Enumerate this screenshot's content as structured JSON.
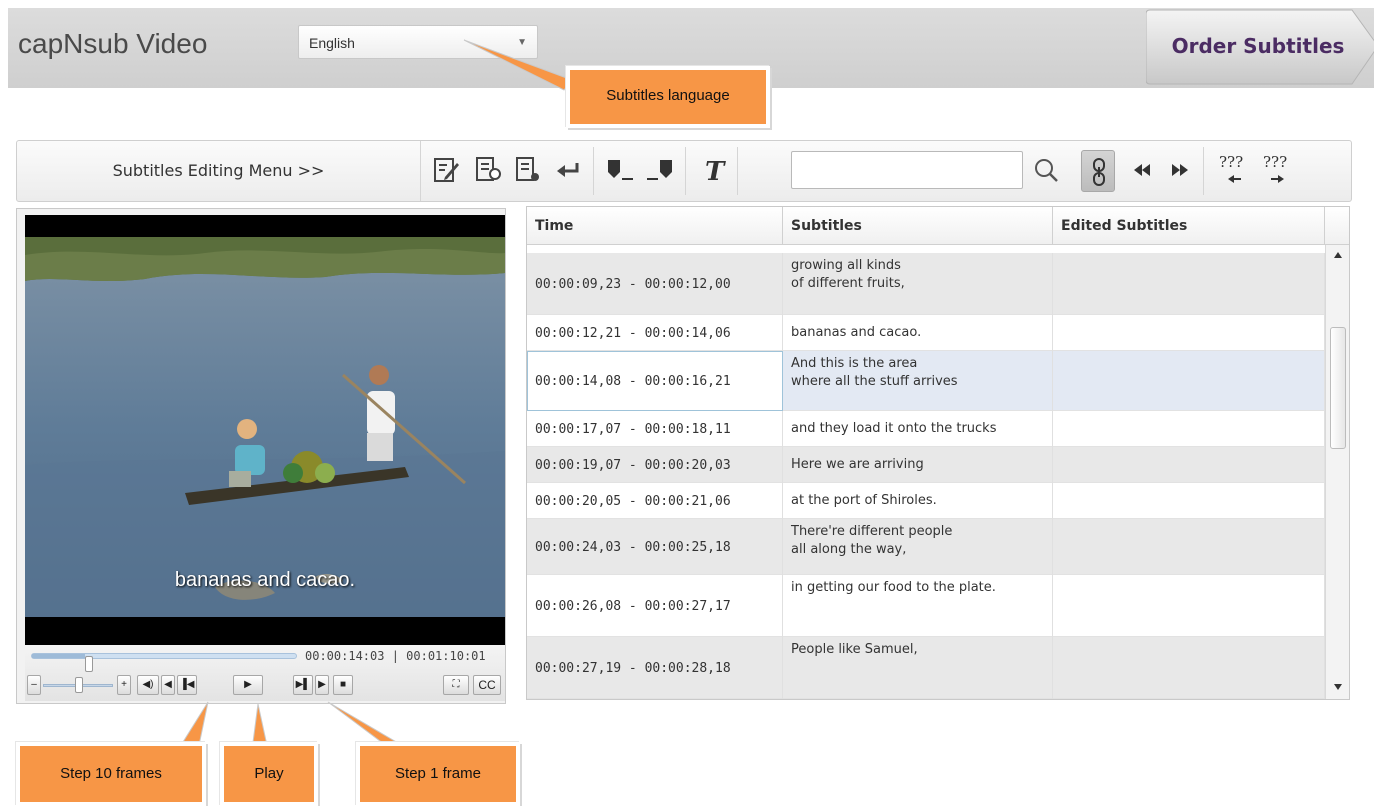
{
  "header": {
    "app_title": "capNsub Video",
    "language": {
      "selected": "English"
    },
    "order_button": "Order Subtitles"
  },
  "toolbar": {
    "menu_label": "Subtitles Editing Menu >>",
    "search_placeholder": "",
    "icons": [
      "edit-icon",
      "insert-before-icon",
      "insert-after-icon",
      "undo-icon",
      "mark-start-icon",
      "mark-end-icon",
      "text-format-icon",
      "search-icon",
      "link-icon",
      "rewind-icon",
      "fast-forward-icon",
      "prev-unknown-icon",
      "next-unknown-icon"
    ],
    "unknown_label": "???"
  },
  "player": {
    "caption": "bananas and cacao.",
    "time_readout": "00:00:14:03 | 00:01:10:01",
    "progress": 0.2,
    "controls": {
      "minus": "–",
      "plus": "+",
      "cc": "CC"
    }
  },
  "table": {
    "columns": [
      "Time",
      "Subtitles",
      "Edited Subtitles"
    ],
    "rows": [
      {
        "time": "00:00:09,23 - 00:00:12,00",
        "text": "growing all kinds\nof different fruits,",
        "edited": ""
      },
      {
        "time": "00:00:12,21 - 00:00:14,06",
        "text": "bananas and cacao.",
        "edited": ""
      },
      {
        "time": "00:00:14,08 - 00:00:16,21",
        "text": "And this is the area\nwhere all the stuff arrives",
        "edited": ""
      },
      {
        "time": "00:00:17,07 - 00:00:18,11",
        "text": "and they load it onto the trucks",
        "edited": ""
      },
      {
        "time": "00:00:19,07 - 00:00:20,03",
        "text": "Here we are arriving",
        "edited": ""
      },
      {
        "time": "00:00:20,05 - 00:00:21,06",
        "text": "at the port of Shiroles.",
        "edited": ""
      },
      {
        "time": "00:00:24,03 - 00:00:25,18",
        "text": "There're different people\nall along the way,",
        "edited": ""
      },
      {
        "time": "00:00:26,08 - 00:00:27,17",
        "text": "in getting our food to the plate.",
        "edited": ""
      },
      {
        "time": "00:00:27,19 - 00:00:28,18",
        "text": "People like Samuel,",
        "edited": ""
      }
    ]
  },
  "callouts": {
    "language": "Subtitles language",
    "step10": "Step 10 frames",
    "play": "Play",
    "step1": "Step 1 frame"
  },
  "colors": {
    "callout": "#f79646",
    "order_text": "#4b2c63",
    "selected_row": "#e3e9f3"
  }
}
